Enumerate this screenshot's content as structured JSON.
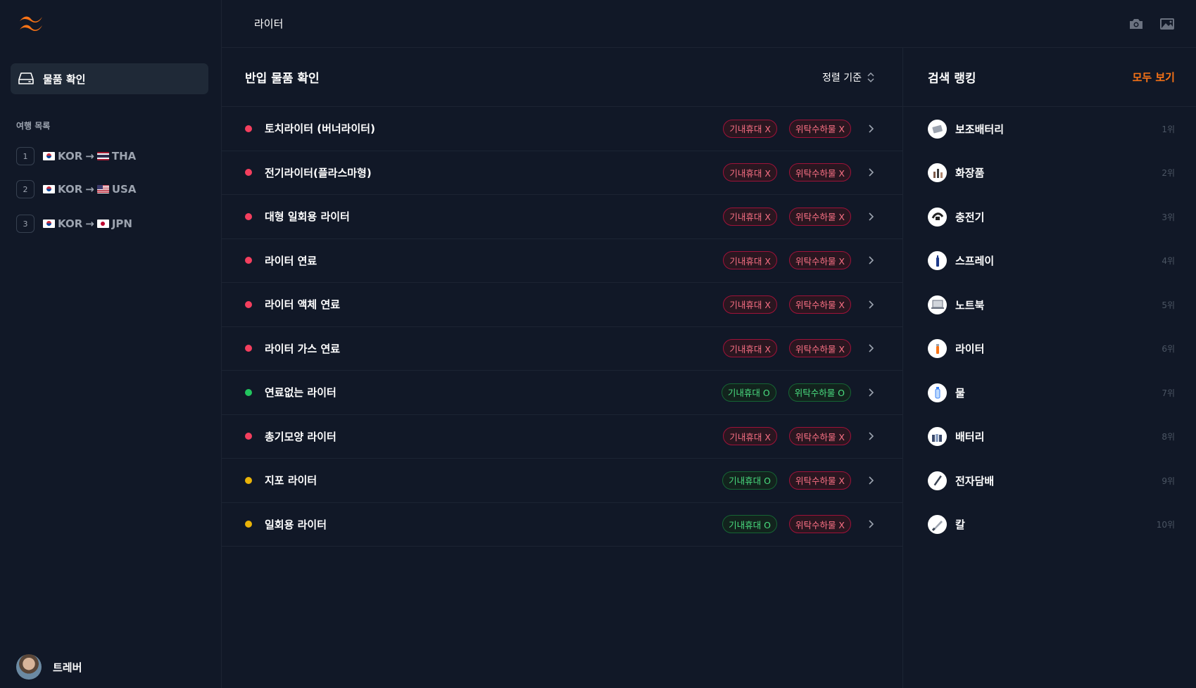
{
  "sidebar": {
    "nav_active_label": "물품 확인",
    "section_title": "여행 목록",
    "trips": [
      {
        "num": "1",
        "from": "KOR",
        "arrow": "→",
        "to": "THA"
      },
      {
        "num": "2",
        "from": "KOR",
        "arrow": "→",
        "to": "USA"
      },
      {
        "num": "3",
        "from": "KOR",
        "arrow": "→",
        "to": "JPN"
      }
    ],
    "user_name": "트레버"
  },
  "topbar": {
    "breadcrumb": "라이터"
  },
  "items_panel": {
    "title": "반입 물품 확인",
    "sort_label": "정렬 기준",
    "rows": [
      {
        "name": "토치라이터 (버너라이터)",
        "status": "red",
        "carry": "기내휴대 X",
        "carry_ok": false,
        "checked": "위탁수하물 X",
        "checked_ok": false
      },
      {
        "name": "전기라이터(플라스마형)",
        "status": "red",
        "carry": "기내휴대 X",
        "carry_ok": false,
        "checked": "위탁수하물 X",
        "checked_ok": false
      },
      {
        "name": "대형 일회용 라이터",
        "status": "red",
        "carry": "기내휴대 X",
        "carry_ok": false,
        "checked": "위탁수하물 X",
        "checked_ok": false
      },
      {
        "name": "라이터 연료",
        "status": "red",
        "carry": "기내휴대 X",
        "carry_ok": false,
        "checked": "위탁수하물 X",
        "checked_ok": false
      },
      {
        "name": "라이터 액체 연료",
        "status": "red",
        "carry": "기내휴대 X",
        "carry_ok": false,
        "checked": "위탁수하물 X",
        "checked_ok": false
      },
      {
        "name": "라이터 가스 연료",
        "status": "red",
        "carry": "기내휴대 X",
        "carry_ok": false,
        "checked": "위탁수하물 X",
        "checked_ok": false
      },
      {
        "name": "연료없는 라이터",
        "status": "green",
        "carry": "기내휴대 O",
        "carry_ok": true,
        "checked": "위탁수하물 O",
        "checked_ok": true
      },
      {
        "name": "총기모양 라이터",
        "status": "red",
        "carry": "기내휴대 X",
        "carry_ok": false,
        "checked": "위탁수하물 X",
        "checked_ok": false
      },
      {
        "name": "지포 라이터",
        "status": "yellow",
        "carry": "기내휴대 O",
        "carry_ok": true,
        "checked": "위탁수하물 X",
        "checked_ok": false
      },
      {
        "name": "일회용 라이터",
        "status": "yellow",
        "carry": "기내휴대 O",
        "carry_ok": true,
        "checked": "위탁수하물 X",
        "checked_ok": false
      }
    ]
  },
  "ranking_panel": {
    "title": "검색 랭킹",
    "see_all": "모두 보기",
    "rows": [
      {
        "name": "보조배터리",
        "rank": "1위",
        "icon": "power-bank-icon"
      },
      {
        "name": "화장품",
        "rank": "2위",
        "icon": "cosmetics-icon"
      },
      {
        "name": "충전기",
        "rank": "3위",
        "icon": "charger-icon"
      },
      {
        "name": "스프레이",
        "rank": "4위",
        "icon": "spray-icon"
      },
      {
        "name": "노트북",
        "rank": "5위",
        "icon": "laptop-icon"
      },
      {
        "name": "라이터",
        "rank": "6위",
        "icon": "lighter-icon"
      },
      {
        "name": "물",
        "rank": "7위",
        "icon": "water-bottle-icon"
      },
      {
        "name": "배터리",
        "rank": "8위",
        "icon": "battery-icon"
      },
      {
        "name": "전자담배",
        "rank": "9위",
        "icon": "e-cigarette-icon"
      },
      {
        "name": "칼",
        "rank": "10위",
        "icon": "knife-icon"
      }
    ]
  },
  "colors": {
    "background": "#111827",
    "accent": "#f97316",
    "danger": "#f43f5e",
    "success": "#22c55e",
    "warning": "#eab308"
  }
}
